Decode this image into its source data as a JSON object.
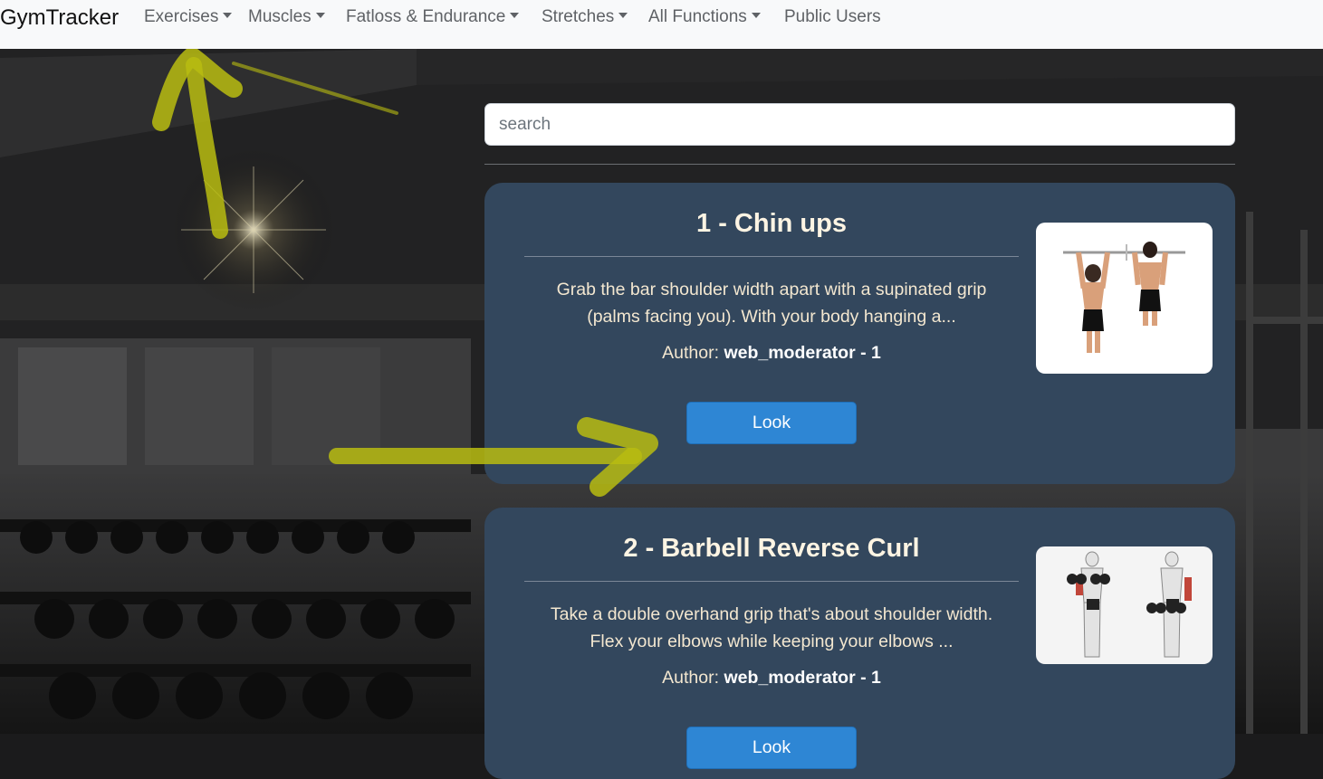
{
  "navbar": {
    "brand": "GymTracker",
    "items": [
      {
        "label": "Exercises",
        "dropdown": true
      },
      {
        "label": "Muscles",
        "dropdown": true
      },
      {
        "label": "Fatloss & Endurance",
        "dropdown": true
      },
      {
        "label": "Stretches",
        "dropdown": true
      },
      {
        "label": "All Functions",
        "dropdown": true
      },
      {
        "label": "Public Users",
        "dropdown": false
      }
    ]
  },
  "search": {
    "placeholder": "search",
    "value": ""
  },
  "exercises": [
    {
      "title": "1 - Chin ups",
      "description_line1": "Grab the bar shoulder width apart with a supinated grip",
      "description_line2": "(palms facing you). With your body hanging a...",
      "author_label": "Author:",
      "author_name": "web_moderator - 1",
      "button_label": "Look",
      "image_icon": "chin-up-figures"
    },
    {
      "title": "2 - Barbell Reverse Curl",
      "description_line1": "Take a double overhand grip that's about shoulder width.",
      "description_line2": "Flex your elbows while keeping your elbows ...",
      "author_label": "Author:",
      "author_name": "web_moderator - 1",
      "button_label": "Look",
      "image_icon": "reverse-curl-figures"
    }
  ],
  "colors": {
    "navbar_bg": "#f8f9fa",
    "card_bg": "#33475d",
    "button_bg": "#2e86d4",
    "annotation_arrow": "#b9bc10"
  }
}
